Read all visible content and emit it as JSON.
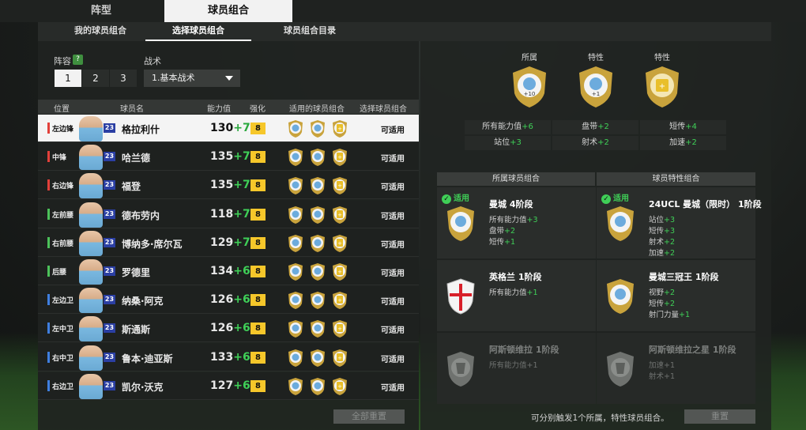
{
  "top_tabs": [
    "阵型",
    "球员组合"
  ],
  "sub_tabs": [
    "我的球员组合",
    "选择球员组合",
    "球员组合目录"
  ],
  "formation": {
    "label": "阵容",
    "help": "?",
    "options": [
      "1",
      "2",
      "3"
    ],
    "selected": "1"
  },
  "tactic": {
    "label": "战术",
    "value": "1.基本战术"
  },
  "table": {
    "headers": [
      "位置",
      "球员名",
      "能力值",
      "强化",
      "适用的球员组合",
      "选择球员组合"
    ],
    "rows": [
      {
        "position": "左边锋",
        "pos_color": "#e2403a",
        "season": "23",
        "name": "格拉利什",
        "rating": "130",
        "bonus": "+7",
        "enhance": "8",
        "status": "可适用",
        "selected": true
      },
      {
        "position": "中锋",
        "pos_color": "#e2403a",
        "season": "23",
        "name": "哈兰德",
        "rating": "135",
        "bonus": "+7",
        "enhance": "8",
        "status": "可适用",
        "selected": false
      },
      {
        "position": "右边锋",
        "pos_color": "#e2403a",
        "season": "23",
        "name": "福登",
        "rating": "135",
        "bonus": "+7",
        "enhance": "8",
        "status": "可适用",
        "selected": false
      },
      {
        "position": "左前腰",
        "pos_color": "#4cc25a",
        "season": "23",
        "name": "德布劳内",
        "rating": "118",
        "bonus": "+7",
        "enhance": "8",
        "status": "可适用",
        "selected": false
      },
      {
        "position": "右前腰",
        "pos_color": "#4cc25a",
        "season": "23",
        "name": "博纳多·席尔瓦",
        "rating": "129",
        "bonus": "+7",
        "enhance": "8",
        "status": "可适用",
        "selected": false
      },
      {
        "position": "后腰",
        "pos_color": "#4cc25a",
        "season": "23",
        "name": "罗德里",
        "rating": "134",
        "bonus": "+6",
        "enhance": "8",
        "status": "可适用",
        "selected": false
      },
      {
        "position": "左边卫",
        "pos_color": "#3f7fe0",
        "season": "23",
        "name": "纳桑·阿克",
        "rating": "126",
        "bonus": "+6",
        "enhance": "8",
        "status": "可适用",
        "selected": false
      },
      {
        "position": "左中卫",
        "pos_color": "#3f7fe0",
        "season": "23",
        "name": "斯通斯",
        "rating": "126",
        "bonus": "+6",
        "enhance": "8",
        "status": "可适用",
        "selected": false
      },
      {
        "position": "右中卫",
        "pos_color": "#3f7fe0",
        "season": "23",
        "name": "鲁本·迪亚斯",
        "rating": "133",
        "bonus": "+6",
        "enhance": "8",
        "status": "可适用",
        "selected": false
      },
      {
        "position": "右边卫",
        "pos_color": "#3f7fe0",
        "season": "23",
        "name": "凯尔·沃克",
        "rating": "127",
        "bonus": "+6",
        "enhance": "8",
        "status": "可适用",
        "selected": false
      }
    ]
  },
  "reset_all": "全部重置",
  "summary": {
    "titles": [
      "所属",
      "特性",
      "特性"
    ],
    "badge_labels": [
      "+10",
      "+1",
      ""
    ],
    "stats": [
      {
        "label": "所有能力值",
        "value": "+6"
      },
      {
        "label": "盘带",
        "value": "+2"
      },
      {
        "label": "短传",
        "value": "+4"
      },
      {
        "label": "站位",
        "value": "+3"
      },
      {
        "label": "射术",
        "value": "+2"
      },
      {
        "label": "加速",
        "value": "+2"
      }
    ]
  },
  "chem_headers": [
    "所属球员组合",
    "球员特性组合"
  ],
  "chem_left": [
    {
      "name": "曼城 4阶段",
      "applied": "适用",
      "stats": [
        [
          "所有能力值",
          "+3"
        ],
        [
          "盘带",
          "+2"
        ],
        [
          "短传",
          "+1"
        ]
      ],
      "dim": false,
      "badge": "city"
    },
    {
      "name": "英格兰 1阶段",
      "applied": "",
      "stats": [
        [
          "所有能力值",
          "+1"
        ]
      ],
      "dim": false,
      "badge": "england"
    },
    {
      "name": "阿斯顿维拉 1阶段",
      "applied": "",
      "stats": [
        [
          "所有能力值",
          "+1"
        ]
      ],
      "dim": true,
      "badge": "villa"
    }
  ],
  "chem_right": [
    {
      "name": "24UCL 曼城（限时） 1阶段",
      "applied": "适用",
      "stats": [
        [
          "站位",
          "+3"
        ],
        [
          "短传",
          "+3"
        ],
        [
          "射术",
          "+2"
        ],
        [
          "加速",
          "+2"
        ]
      ],
      "dim": false,
      "badge": "city"
    },
    {
      "name": "曼城三冠王 1阶段",
      "applied": "",
      "stats": [
        [
          "视野",
          "+2"
        ],
        [
          "短传",
          "+2"
        ],
        [
          "射门力量",
          "+1"
        ]
      ],
      "dim": false,
      "badge": "city"
    },
    {
      "name": "阿斯顿维拉之星 1阶段",
      "applied": "",
      "stats": [
        [
          "加速",
          "+1"
        ],
        [
          "射术",
          "+1"
        ]
      ],
      "dim": true,
      "badge": "villa"
    }
  ],
  "footer_note": "可分别触发1个所属，特性球员组合。",
  "reset": "重置",
  "icons": {
    "applied": "check-circle-icon",
    "club": "city-crest-icon",
    "trait": "gold-plus-icon",
    "dropdown": "caret-down-icon"
  }
}
